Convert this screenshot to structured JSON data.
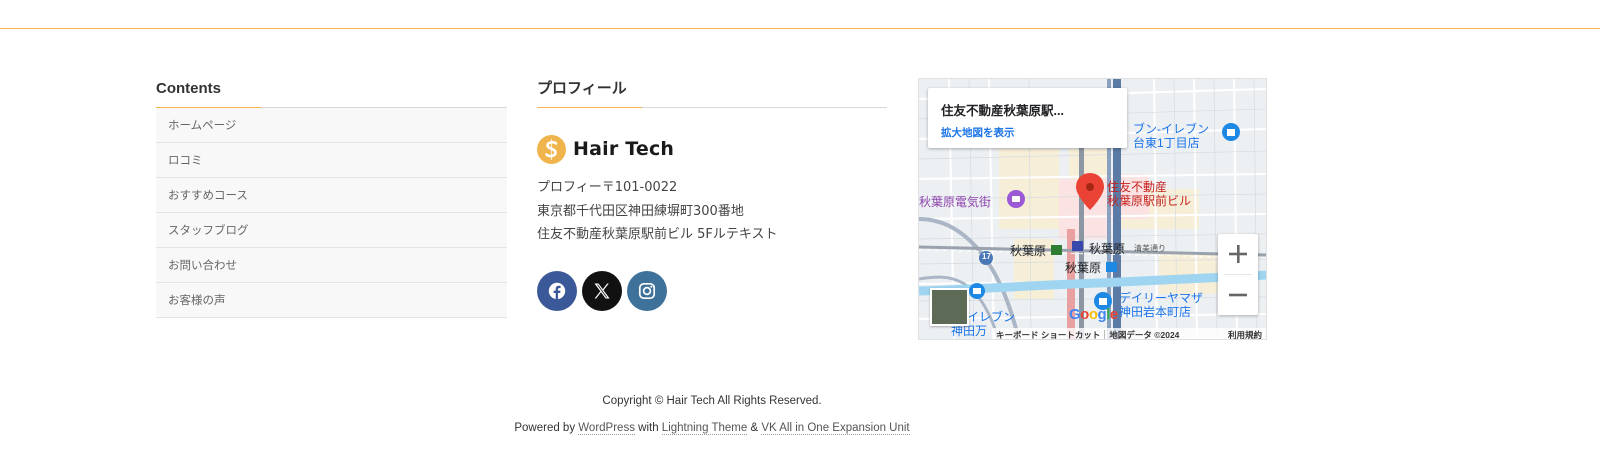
{
  "contents": {
    "title": "Contents",
    "items": [
      {
        "label": "ホームページ"
      },
      {
        "label": "ロコミ"
      },
      {
        "label": "おすすめコース"
      },
      {
        "label": "スタッフブログ"
      },
      {
        "label": "お問い合わせ"
      },
      {
        "label": "お客様の声"
      }
    ]
  },
  "profile": {
    "title": "プロフィール",
    "logo_text": "Hair Tech",
    "address": [
      "プロフィー〒101-0022",
      "東京都千代田区神田練塀町300番地",
      "住友不動産秋葉原駅前ビル 5Fルテキスト"
    ],
    "social": [
      {
        "icon": "facebook-icon",
        "color": "#3b5998"
      },
      {
        "icon": "x-twitter-icon",
        "color": "#111111"
      },
      {
        "icon": "instagram-icon",
        "color": "#3f729b"
      }
    ]
  },
  "map": {
    "card_title": "住友不動産秋葉原駅...",
    "card_link": "拡大地図を表示",
    "marker_label_1": "住友不動産",
    "marker_label_2": "秋葉原駅前ビル",
    "labels": {
      "seven_eleven_1": "ブン-イレブン",
      "seven_eleven_1b": "台東1丁目店",
      "denkigai": "秋葉原電気街",
      "akiba_jr": "秋葉原",
      "akiba_tx": "秋葉原",
      "akiba_metro": "秋葉原",
      "seiyu": "清美通り",
      "route": "17",
      "daily_1": "デイリーヤマザ",
      "daily_2": "神田岩本町店",
      "seven_eleven_2": "ン-イレブン",
      "seven_eleven_2b": "神田万"
    },
    "google": "Google",
    "footer_keyboard": "キーボード ショートカット",
    "footer_data": "地図データ ©2024",
    "footer_terms": "利用規約"
  },
  "footer": {
    "copyright": "Copyright © Hair Tech All Rights Reserved.",
    "powered_prefix": "Powered by ",
    "wordpress": "WordPress",
    "with": " with ",
    "lightning": "Lightning Theme",
    "amp": " & ",
    "vk": "VK All in One Expansion Unit"
  },
  "colors": {
    "accent": "#f3b24e",
    "link": "#1a73e8",
    "marker": "#ea4335"
  }
}
